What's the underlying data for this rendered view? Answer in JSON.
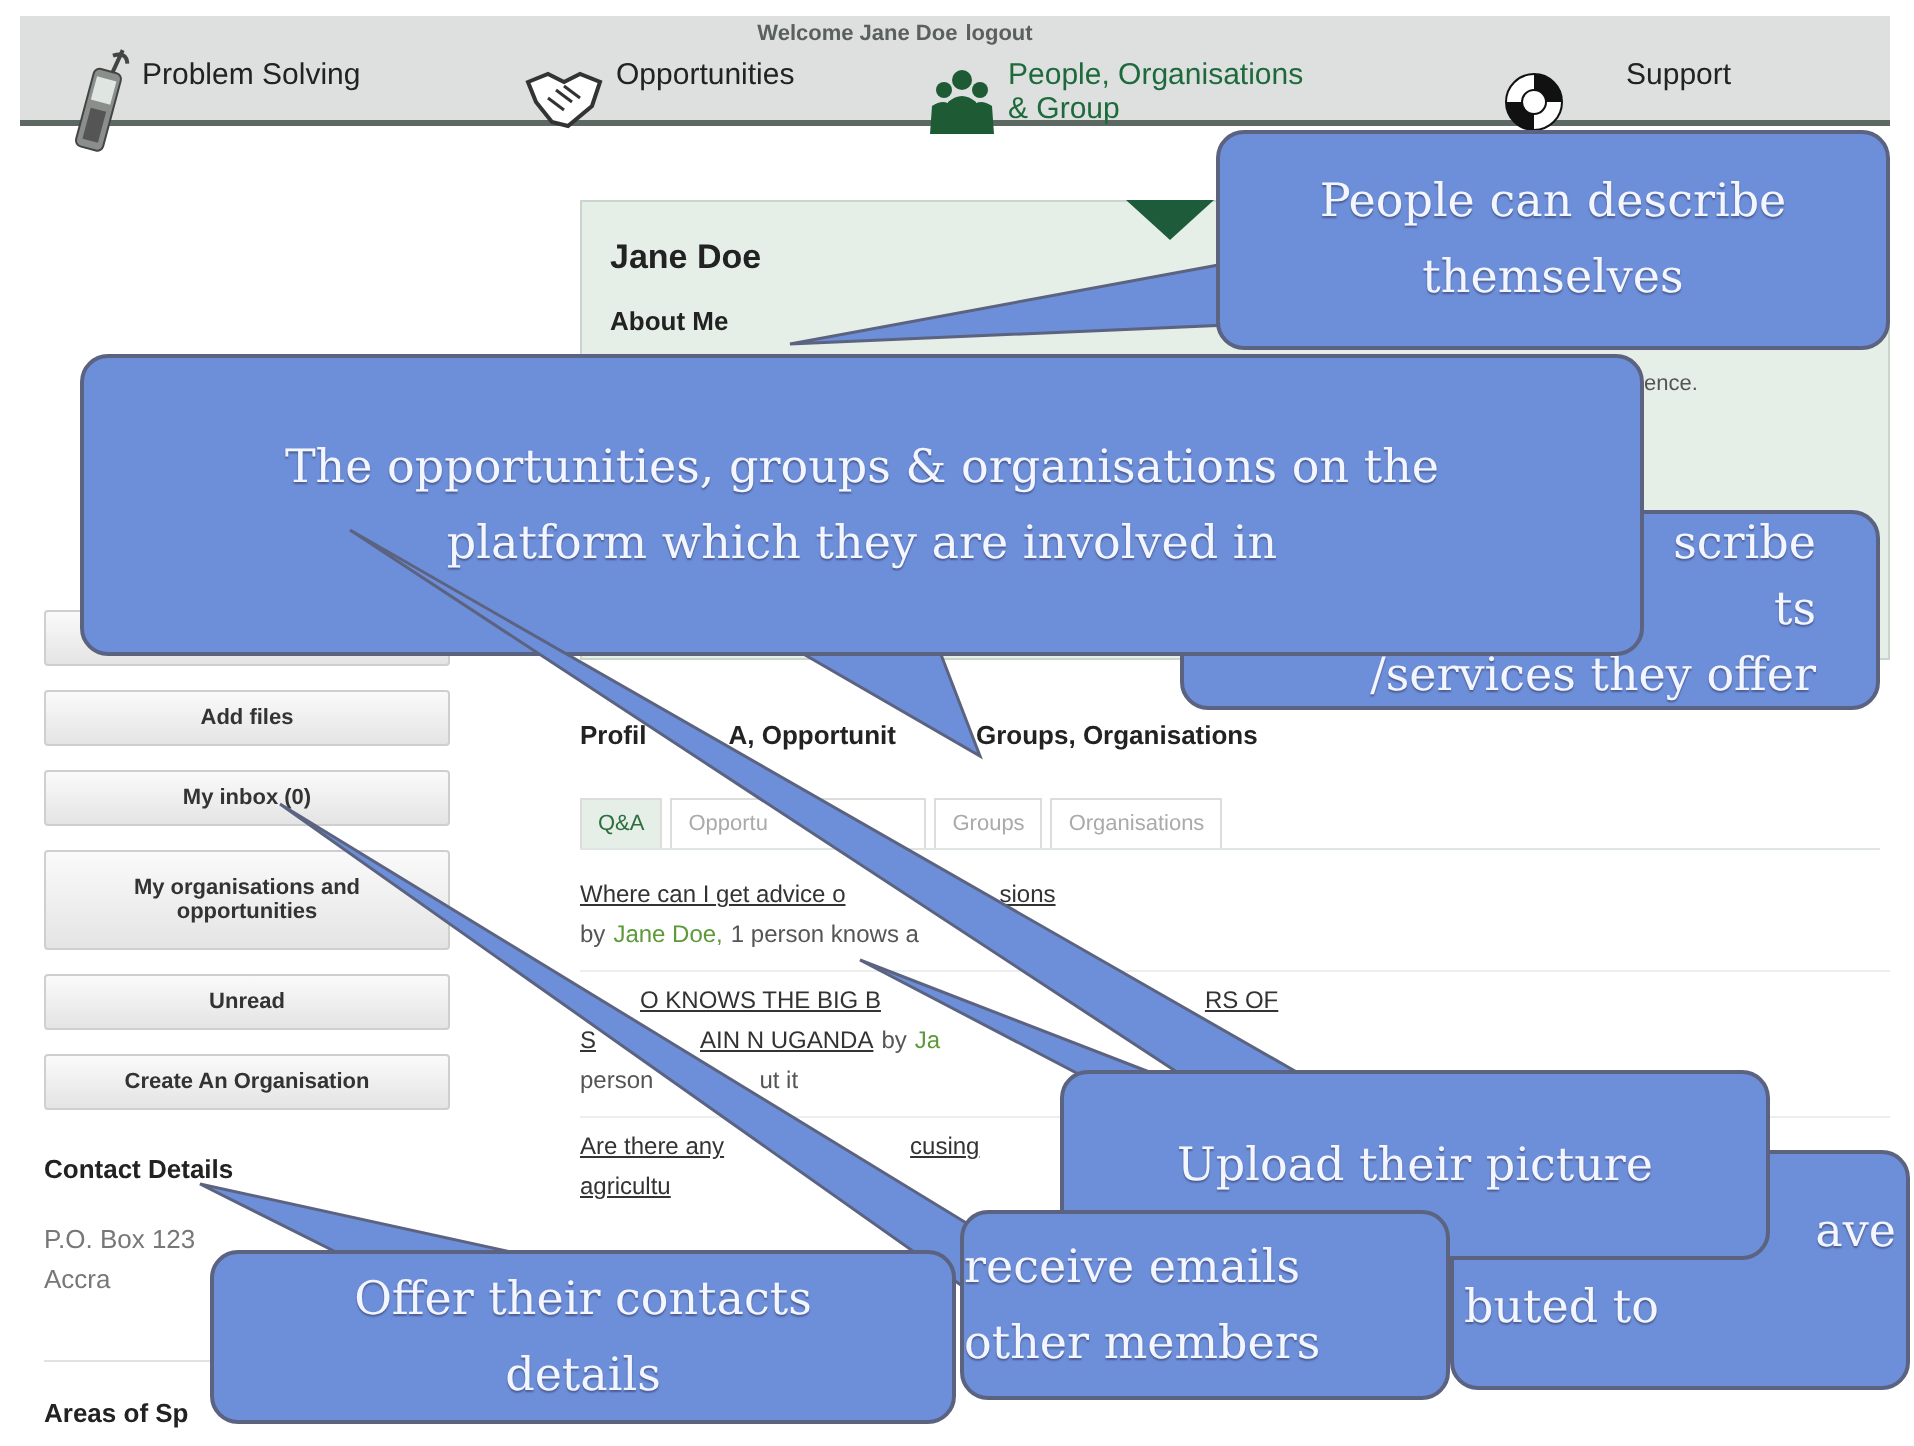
{
  "header": {
    "welcome": "Welcome Jane Doe",
    "logout": "logout"
  },
  "nav": [
    {
      "label": "Problem Solving",
      "kind": "phone",
      "selected": false
    },
    {
      "label": "Opportunities",
      "kind": "handshake",
      "selected": false
    },
    {
      "label": "People, Organisations",
      "sublabel": "& Group",
      "kind": "people",
      "selected": true
    },
    {
      "label": "Support",
      "kind": "lifebuoy",
      "selected": false
    }
  ],
  "sidebar": {
    "buttons": [
      {
        "kind": "covered"
      },
      {
        "kind": "labelled",
        "label": "Add files"
      },
      {
        "kind": "labelled",
        "label": "My inbox (0)"
      },
      {
        "kind": "labelled",
        "label": "My organisations and opportunities"
      },
      {
        "kind": "labelled",
        "label": "Unread"
      },
      {
        "kind": "labelled",
        "label": "Create An Organisation"
      }
    ],
    "contact": {
      "heading": "Contact Details",
      "lines": [
        "P.O. Box 123",
        "Accra"
      ]
    },
    "areas_heading": "Areas of Sp"
  },
  "profile": {
    "name": "Jane Doe",
    "about_heading": "About Me",
    "about_text": "ence."
  },
  "section": {
    "heading": [
      {
        "text": "Profil"
      },
      {
        "text": "A, Opportunit",
        "gap": true
      },
      {
        "text": "Groups, Organisations",
        "gap": true
      }
    ],
    "tabs": [
      {
        "label": "Q&A",
        "selected": true
      },
      {
        "label": "Opportu",
        "selected": false
      },
      {
        "label": "Groups",
        "selected": false
      },
      {
        "label": "Organisations",
        "selected": false
      }
    ],
    "questions": [
      {
        "lines": [
          [
            {
              "text": "Where can I get advice o",
              "kind": "link"
            },
            {
              "text": "sions",
              "kind": "link",
              "gap": true
            }
          ],
          [
            {
              "text": "by",
              "kind": "plain"
            },
            {
              "text": "Jane Doe,",
              "kind": "author"
            },
            {
              "text": "1 person knows a",
              "kind": "plain"
            }
          ]
        ]
      },
      {
        "lines": [
          [
            {
              "text": "O KNOWS THE BIG B",
              "kind": "link",
              "gap": true
            },
            {
              "text": "RS OF",
              "kind": "link",
              "gap": true
            }
          ],
          [
            {
              "text": "S",
              "kind": "link"
            },
            {
              "text": "AIN N UGANDA",
              "kind": "link",
              "gap": true
            },
            {
              "text": "by",
              "kind": "plain"
            },
            {
              "text": "Ja",
              "kind": "author"
            }
          ],
          [
            {
              "text": "person",
              "kind": "plain"
            },
            {
              "text": "ut it",
              "kind": "plain",
              "gap": true
            }
          ]
        ]
      },
      {
        "lines": [
          [
            {
              "text": "Are there any",
              "kind": "link"
            },
            {
              "text": "cusing",
              "kind": "link",
              "gap": true
            }
          ],
          [
            {
              "text": "agricultu",
              "kind": "link"
            }
          ]
        ]
      }
    ]
  },
  "callouts": [
    {
      "lines": [
        "People can describe",
        "themselves"
      ]
    },
    {
      "lines": [
        "scribe",
        "ts",
        "/services they offer"
      ]
    },
    {
      "lines": [
        "The opportunities,  groups & organisations on the",
        "platform which they are involved in"
      ]
    },
    {
      "lines": [
        "ave",
        "buted to"
      ]
    },
    {
      "lines": [
        "Upload their picture"
      ]
    },
    {
      "lines": [
        "receive emails",
        "other members"
      ]
    },
    {
      "lines": [
        "Offer their contacts",
        "details"
      ]
    }
  ]
}
